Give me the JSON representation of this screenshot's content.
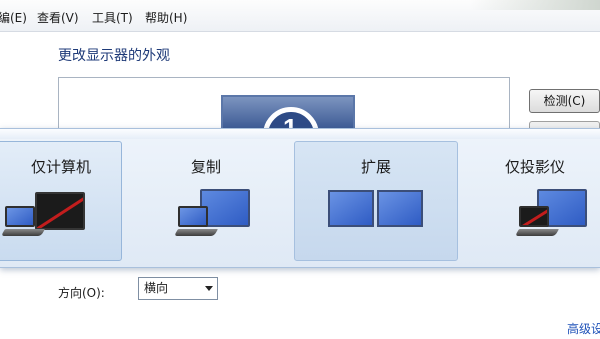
{
  "menubar": {
    "items": [
      "编(E)",
      "查看(V)",
      "工具(T)",
      "帮助(H)"
    ]
  },
  "display_settings": {
    "section_title": "更改显示器的外观",
    "monitor_number": "1",
    "detect_button": "检测(C)",
    "orientation_label": "方向(O):",
    "orientation_value": "横向",
    "advanced_link": "高级设"
  },
  "switcher": {
    "options": [
      {
        "label": "仅计算机",
        "state": "selected"
      },
      {
        "label": "复制",
        "state": "normal"
      },
      {
        "label": "扩展",
        "state": "hover"
      },
      {
        "label": "仅投影仪",
        "state": "normal"
      }
    ]
  },
  "colors": {
    "accent_blue": "#2f5cc4",
    "disabled_slash": "#c21d1d",
    "link": "#1f52b8"
  }
}
